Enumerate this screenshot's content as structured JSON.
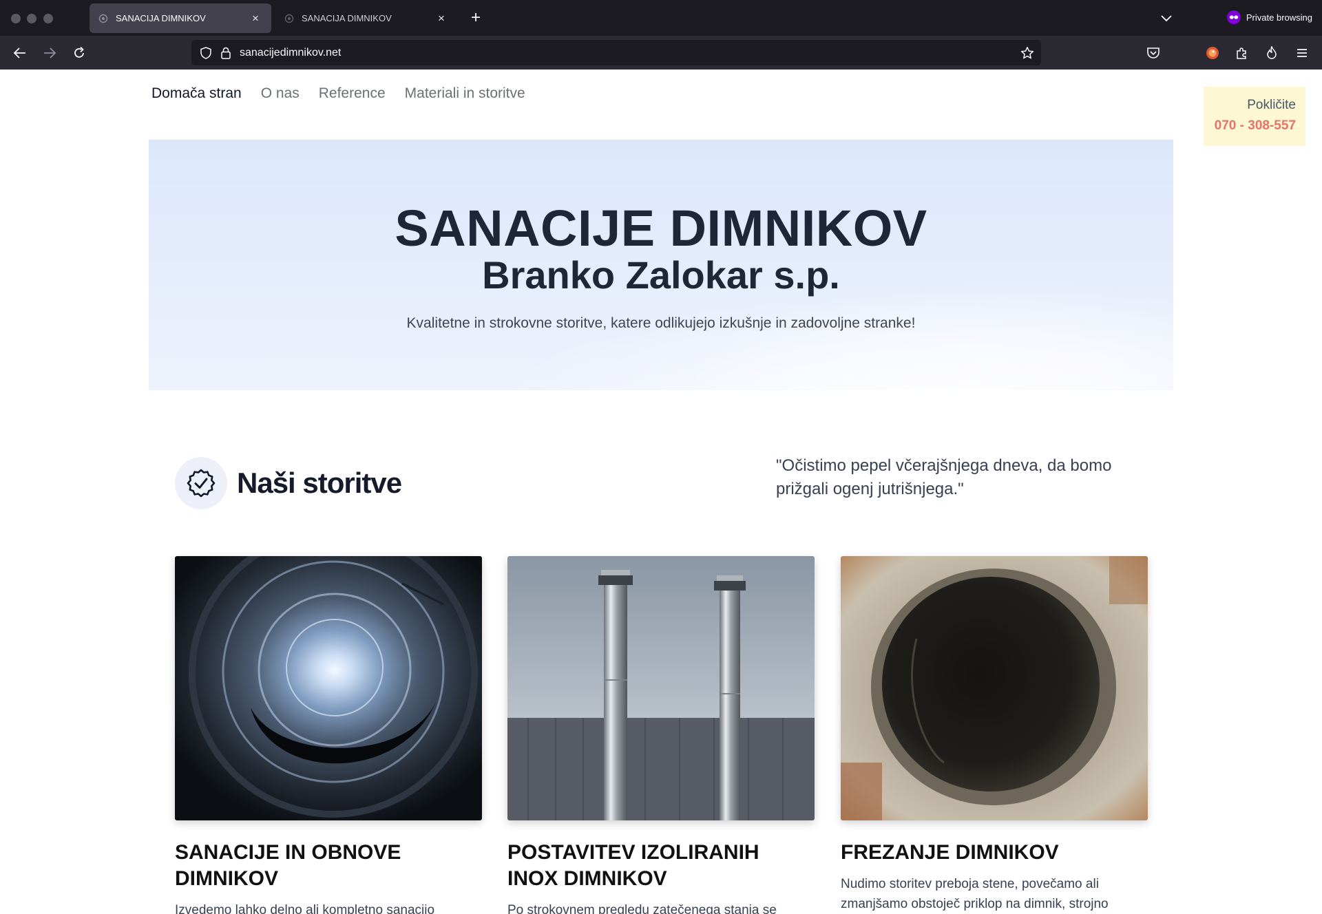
{
  "browser": {
    "tabs": [
      {
        "title": "SANACIJA DIMNIKOV",
        "active": true
      },
      {
        "title": "SANACIJA DIMNIKOV",
        "active": false
      }
    ],
    "private_label": "Private browsing",
    "url": "sanacijedimnikov.net",
    "colors": {
      "tabbar": "#1c1b22",
      "navbar": "#2b2a33",
      "active_tab": "#42414d",
      "private_badge": "#8000d7"
    }
  },
  "nav": {
    "items": [
      {
        "label": "Domača stran",
        "current": true
      },
      {
        "label": "O nas",
        "current": false
      },
      {
        "label": "Reference",
        "current": false
      },
      {
        "label": "Materiali in storitve",
        "current": false
      }
    ]
  },
  "call": {
    "label": "Pokličite",
    "phone": "070 - 308-557",
    "phone_color": "#e8736b",
    "bg_color": "#fdf7d3"
  },
  "hero": {
    "title": "SANACIJE DIMNIKOV",
    "subtitle": "Branko Zalokar s.p.",
    "tagline": "Kvalitetne in strokovne storitve, katere odlikujejo izkušnje in zadovoljne stranke!"
  },
  "services": {
    "icon": "badge-check-icon",
    "title": "Naši storitve",
    "quote": "\"Očistimo pepel včerajšnjega dneva, da bomo prižgali ogenj jutrišnjega.\"",
    "cards": [
      {
        "title": "SANACIJE IN OBNOVE DIMNIKOV",
        "text": "Izvedemo lahko delno ali kompletno sanacijo",
        "image": "chimney-interior-photo"
      },
      {
        "title": "POSTAVITEV IZOLIRANIH INOX DIMNIKOV",
        "text": "Po strokovnem pregledu zatečenega stanja se",
        "image": "inox-chimneys-photo"
      },
      {
        "title": "FREZANJE DIMNIKOV",
        "text": "Nudimo storitev preboja stene, povečamo ali zmanjšamo obstoječ priklop na dimnik, strojno",
        "image": "milled-chimney-hole-photo"
      }
    ]
  }
}
